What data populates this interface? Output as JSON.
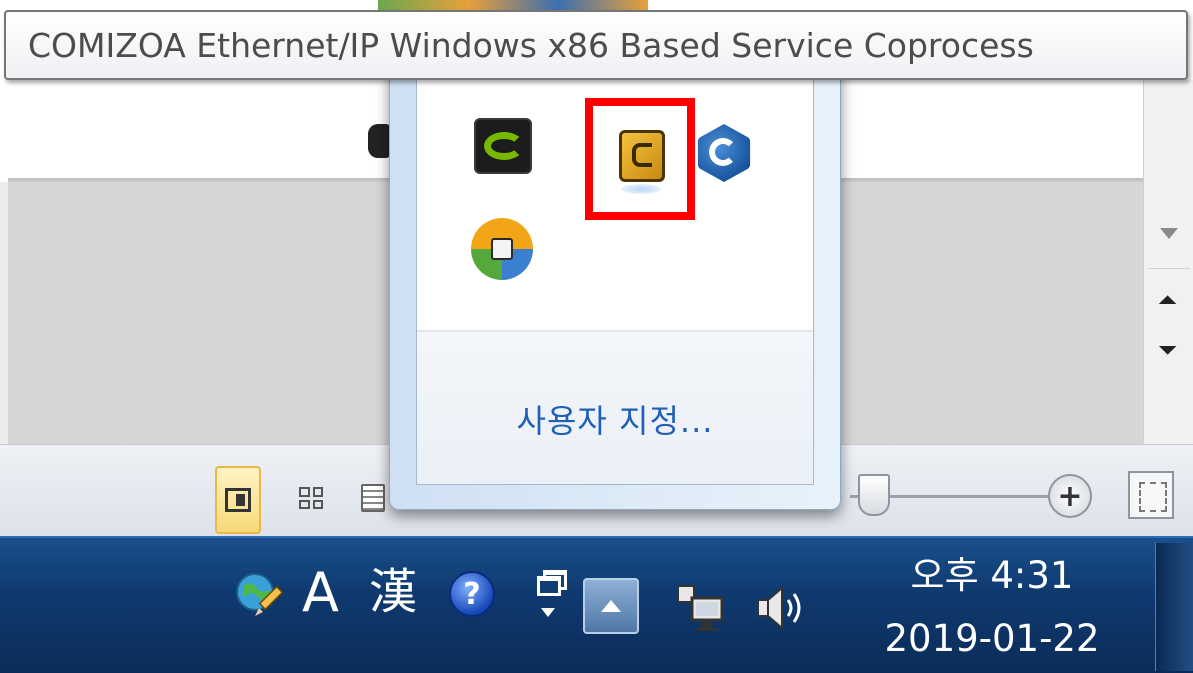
{
  "tooltip": {
    "text": "COMIZOA Ethernet/IP Windows x86 Based Service Coprocess"
  },
  "overflow_popup": {
    "icons": [
      {
        "icon": "nvidia-icon",
        "name": "NVIDIA"
      },
      {
        "icon": "comizoa-service-icon",
        "highlighted": true,
        "highlight_color": "#ff0000"
      },
      {
        "icon": "blue-hexagon-app-icon"
      },
      {
        "icon": "colorful-ring-app-icon"
      }
    ],
    "customize_label": "사용자 지정..."
  },
  "taskbar": {
    "ime_mode_label": "A",
    "hanja_label": "漢",
    "help_label": "?",
    "clock": {
      "time": "오후 4:31",
      "date": "2019-01-22"
    }
  },
  "colors": {
    "taskbar": "#0f3a70",
    "link": "#1f5fb8",
    "highlight": "#ff0000",
    "tooltip_text": "#4c4c4c"
  }
}
